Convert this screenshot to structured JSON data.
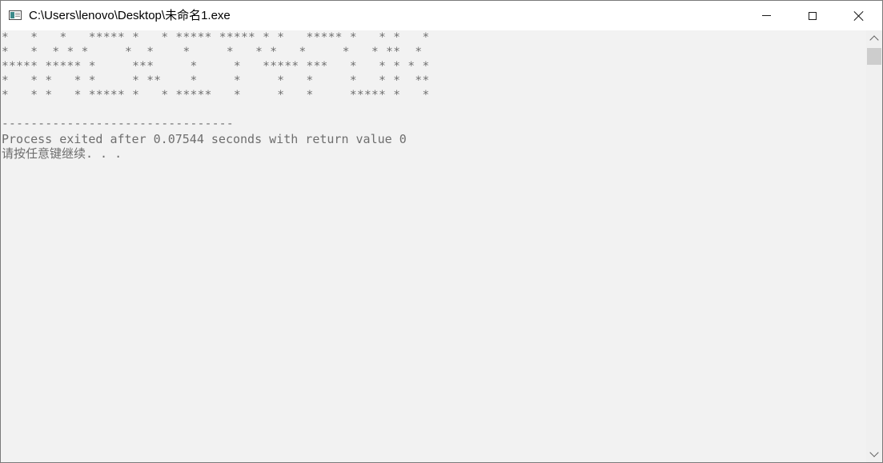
{
  "window": {
    "title": "C:\\Users\\lenovo\\Desktop\\未命名1.exe",
    "icon": "console-app-icon",
    "controls": {
      "minimize_icon": "minimize-icon",
      "maximize_icon": "maximize-icon",
      "close_icon": "close-icon"
    }
  },
  "console": {
    "text_color": "#6e6e6e",
    "background": "#f2f2f2",
    "ascii_art": [
      "*   *   *   ***** *   * ***** ***** * *   ***** *   * *   *",
      "*   *  * * *     *  *    *     *   * *   *     *   * **  *",
      "***** ***** *     ***     *     *   ***** ***   *   * * * *",
      "*   * *   * *     * **    *     *     *   *     *   * *  **",
      "*   * *   * ***** *   * *****   *     *   *     ***** *   *"
    ],
    "separator": "--------------------------------",
    "process_message": "Process exited after 0.07544 seconds with return value 0",
    "prompt": "请按任意键继续. . ."
  },
  "scrollbar": {
    "up_icon": "scroll-up-icon",
    "down_icon": "scroll-down-icon"
  }
}
